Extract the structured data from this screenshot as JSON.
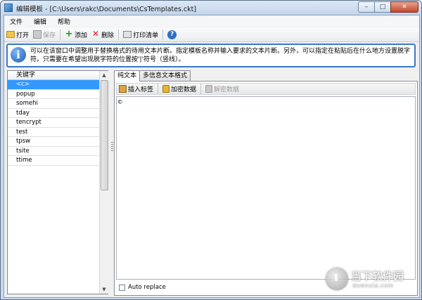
{
  "window": {
    "title": "编辑模板 - [C:\\Users\\rakc\\Documents\\CsTemplates.ckt]",
    "controls": {
      "minimize": "–",
      "maximize": "□",
      "close": "✕"
    }
  },
  "menu": [
    "文件",
    "编辑",
    "帮助"
  ],
  "toolbar": {
    "open_label": "打开",
    "save_label": "保存",
    "add_label": "添加",
    "delete_label": "删除",
    "print_label": "打印清单",
    "help_glyph": "?"
  },
  "info": {
    "icon_glyph": "i",
    "text": "可以在该窗口中调整用于替换格式的待用文本片断。指定模板名称并输入要求的文本片断。另外，可以指定在粘贴后在什么地方设置脱字符。只需要在希望出现脱字符的位置按'|'符号（竖线）。"
  },
  "keyword_list": {
    "header": "关键字",
    "items": [
      "<c>",
      "popup",
      "somehi",
      "tday",
      "tencrypt",
      "test",
      "tpsw",
      "tsite",
      "ttime"
    ],
    "selected_index": 0
  },
  "tabs": [
    "纯文本",
    "多信息文本格式"
  ],
  "active_tab": 0,
  "editor_toolbar": {
    "insert_tag_label": "插入标签",
    "encrypt_label": "加密数据",
    "decrypt_label": "解密数据"
  },
  "editor": {
    "content": "©"
  },
  "auto_replace": {
    "label": "Auto replace",
    "checked": false
  },
  "watermark": {
    "cn": "当下软件园",
    "en": "downxia.com"
  }
}
